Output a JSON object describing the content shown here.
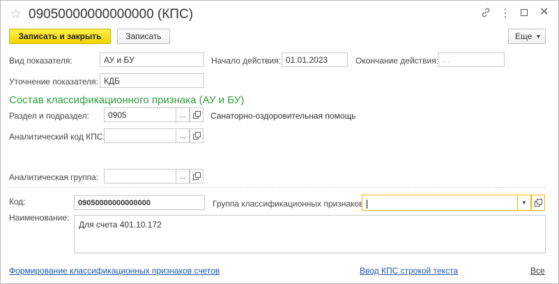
{
  "window": {
    "title": "09050000000000000 (КПС)",
    "icons": {
      "star": "star-icon",
      "link": "link-icon",
      "menu": "more-icon",
      "maximize": "maximize-icon",
      "close": "close-icon"
    }
  },
  "toolbar": {
    "save_close_label": "Записать и закрыть",
    "save_label": "Записать",
    "more_label": "Еще"
  },
  "form": {
    "indicator_type": {
      "label": "Вид показателя:",
      "value": "АУ и БУ"
    },
    "start_date": {
      "label": "Начало действия:",
      "value": "01.01.2023"
    },
    "end_date": {
      "label": "Окончание действия:",
      "value": " .  ."
    },
    "indicator_refinement": {
      "label": "Уточнение показателя:",
      "value": "КДБ"
    },
    "section_title": "Состав классификационного признака (АУ и БУ)",
    "section_subsection": {
      "label": "Раздел и подраздел:",
      "value": "0905",
      "description": "Санаторно-оздоровительная помощь"
    },
    "analytic_code": {
      "label": "Аналитический код КПС:",
      "value": ""
    },
    "analytic_group": {
      "label": "Аналитическая группа:",
      "value": ""
    },
    "code": {
      "label": "Код:",
      "value": "09050000000000000"
    },
    "class_group": {
      "label": "Группа классификационных признаков:",
      "value": ""
    },
    "name": {
      "label": "Наименование:",
      "value": "Для счета 401.10.172"
    },
    "ellipsis": "..."
  },
  "footer": {
    "link_left": "Формирование классификационных признаков счетов",
    "link_mid": "Ввод КПС строкой текста",
    "link_right": "Все"
  },
  "colors": {
    "accent": "#f2d500",
    "section": "#2f9e3b",
    "link": "#1a55a8",
    "focus": "#f5b700"
  }
}
